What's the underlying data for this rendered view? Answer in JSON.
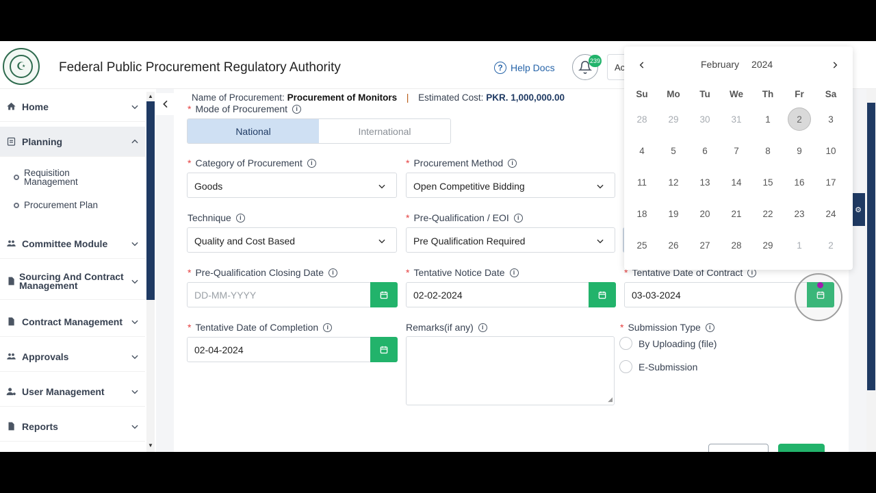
{
  "header": {
    "title": "Federal Public Procurement Regulatory Authority",
    "help_label": "Help Docs",
    "notification_count": "239",
    "account_text": "Ac"
  },
  "sidebar": {
    "items": [
      {
        "label": "Home",
        "icon": "home-icon"
      },
      {
        "label": "Planning",
        "icon": "clipboard-icon"
      },
      {
        "label": "Committee Module",
        "icon": "users-icon"
      },
      {
        "label": "Sourcing And Contract Management",
        "icon": "file-icon"
      },
      {
        "label": "Contract Management",
        "icon": "contract-icon"
      },
      {
        "label": "Approvals",
        "icon": "approvals-icon"
      },
      {
        "label": "User Management",
        "icon": "user-gear-icon"
      },
      {
        "label": "Reports",
        "icon": "report-icon"
      }
    ],
    "sub_items": [
      {
        "label": "Requisition Management"
      },
      {
        "label": "Procurement Plan"
      }
    ]
  },
  "procurement": {
    "name_label": "Name of Procurement:",
    "name_value": "Procurement of Monitors",
    "cost_label": "Estimated Cost:",
    "cost_value": "PKR. 1,000,000.00"
  },
  "form": {
    "mode_label": "Mode of Procurement",
    "mode_options": [
      "National",
      "International"
    ],
    "category_label": "Category of Procurement",
    "category_value": "Goods",
    "method_label": "Procurement Method",
    "method_value": "Open Competitive Bidding",
    "technique_label": "Technique",
    "technique_value": "Quality and Cost Based",
    "prequal_label": "Pre-Qualification / EOI",
    "prequal_value": "Pre Qualification Required",
    "prequal_closing_label": "Pre-Qualification Closing Date",
    "prequal_closing_placeholder": "DD-MM-YYYY",
    "notice_label": "Tentative Notice Date",
    "notice_value": "02-02-2024",
    "contract_label": "Tentative Date of Contract",
    "contract_value": "03-03-2024",
    "completion_label": "Tentative Date of Completion",
    "completion_value": "02-04-2024",
    "remarks_label": "Remarks(if any)",
    "submission_label": "Submission Type",
    "submission_options": [
      "By Uploading (file)",
      "E-Submission"
    ]
  },
  "calendar": {
    "month": "February",
    "year": "2024",
    "weekdays": [
      "Su",
      "Mo",
      "Tu",
      "We",
      "Th",
      "Fr",
      "Sa"
    ],
    "weeks": [
      [
        "28",
        "29",
        "30",
        "31",
        "1",
        "2",
        "3"
      ],
      [
        "4",
        "5",
        "6",
        "7",
        "8",
        "9",
        "10"
      ],
      [
        "11",
        "12",
        "13",
        "14",
        "15",
        "16",
        "17"
      ],
      [
        "18",
        "19",
        "20",
        "21",
        "22",
        "23",
        "24"
      ],
      [
        "25",
        "26",
        "27",
        "28",
        "29",
        "1",
        "2"
      ]
    ],
    "selected": "2"
  },
  "colors": {
    "accent_green": "#22b36b",
    "navy": "#1f3a63",
    "segment_active": "#cfe0f3"
  }
}
